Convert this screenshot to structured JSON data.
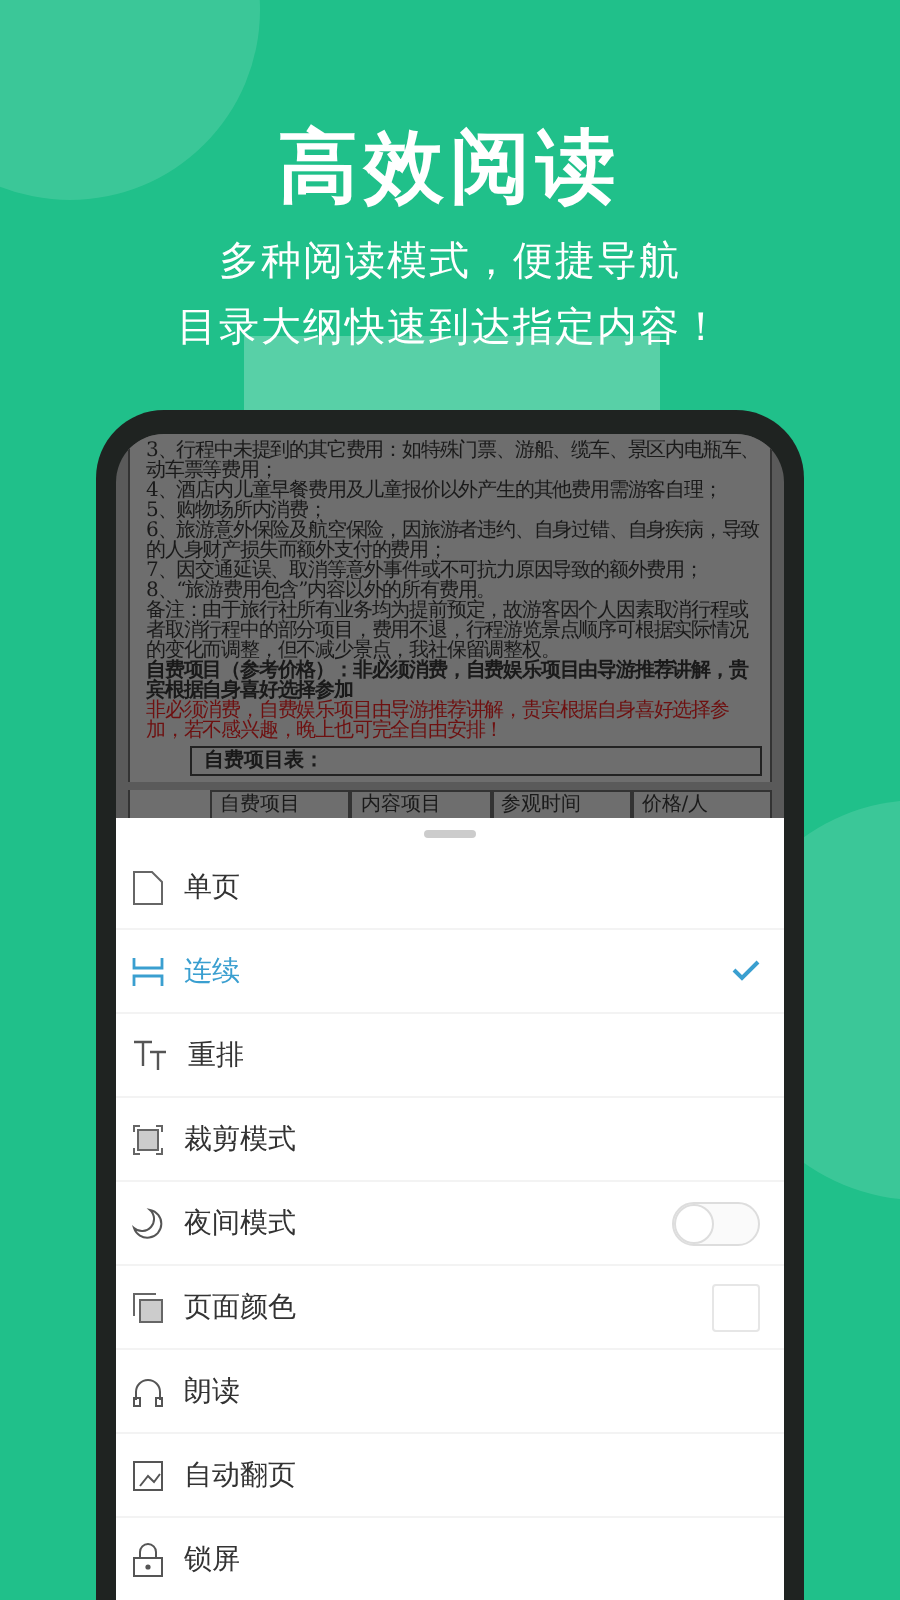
{
  "title": "高效阅读",
  "subtitle_lines": [
    "多种阅读模式，便捷导航",
    "目录大纲快速到达指定内容！"
  ],
  "document": {
    "lines": [
      {
        "kind": "text",
        "text": "3、行程中未提到的其它费用：如特殊门票、游船、缆车、景区内电瓶车、动车票等费用；"
      },
      {
        "kind": "text",
        "text": "4、酒店内儿童早餐费用及儿童报价以外产生的其他费用需游客自理；"
      },
      {
        "kind": "text",
        "text": "5、购物场所内消费；"
      },
      {
        "kind": "text",
        "text": "6、旅游意外保险及航空保险，因旅游者违约、自身过错、自身疾病，导致的人身财产损失而额外支付的费用；"
      },
      {
        "kind": "text",
        "text": "7、因交通延误、取消等意外事件或不可抗力原因导致的额外费用；"
      },
      {
        "kind": "text",
        "text": "8、“旅游费用包含”内容以外的所有费用。"
      },
      {
        "kind": "text",
        "text": "备注：由于旅行社所有业务均为提前预定，故游客因个人因素取消行程或者取消行程中的部分项目，费用不退，行程游览景点顺序可根据实际情况的变化而调整，但不减少景点，我社保留调整权。"
      },
      {
        "kind": "bold",
        "text": "自费项目（参考价格）：非必须消费，自费娱乐项目由导游推荐讲解，贵宾根据自身喜好选择参加"
      },
      {
        "kind": "red",
        "text": "非必须消费，自费娱乐项目由导游推荐讲解，贵宾根据自身喜好选择参加，若不感兴趣，晚上也可完全自由安排！"
      }
    ],
    "table_title": "自费项目表：",
    "columns": [
      "自费项目",
      "内容项目",
      "参观时间",
      "价格/人"
    ]
  },
  "menu": [
    {
      "kind": "option",
      "label": "单页",
      "selected": false
    },
    {
      "kind": "option",
      "label": "连续",
      "selected": true
    },
    {
      "kind": "option",
      "label": "重排",
      "selected": false
    },
    {
      "kind": "action",
      "label": "裁剪模式"
    },
    {
      "kind": "toggle",
      "label": "夜间模式",
      "on": false
    },
    {
      "kind": "swatch",
      "label": "页面颜色"
    },
    {
      "kind": "action",
      "label": "朗读"
    },
    {
      "kind": "action",
      "label": "自动翻页"
    },
    {
      "kind": "action",
      "label": "锁屏"
    }
  ]
}
